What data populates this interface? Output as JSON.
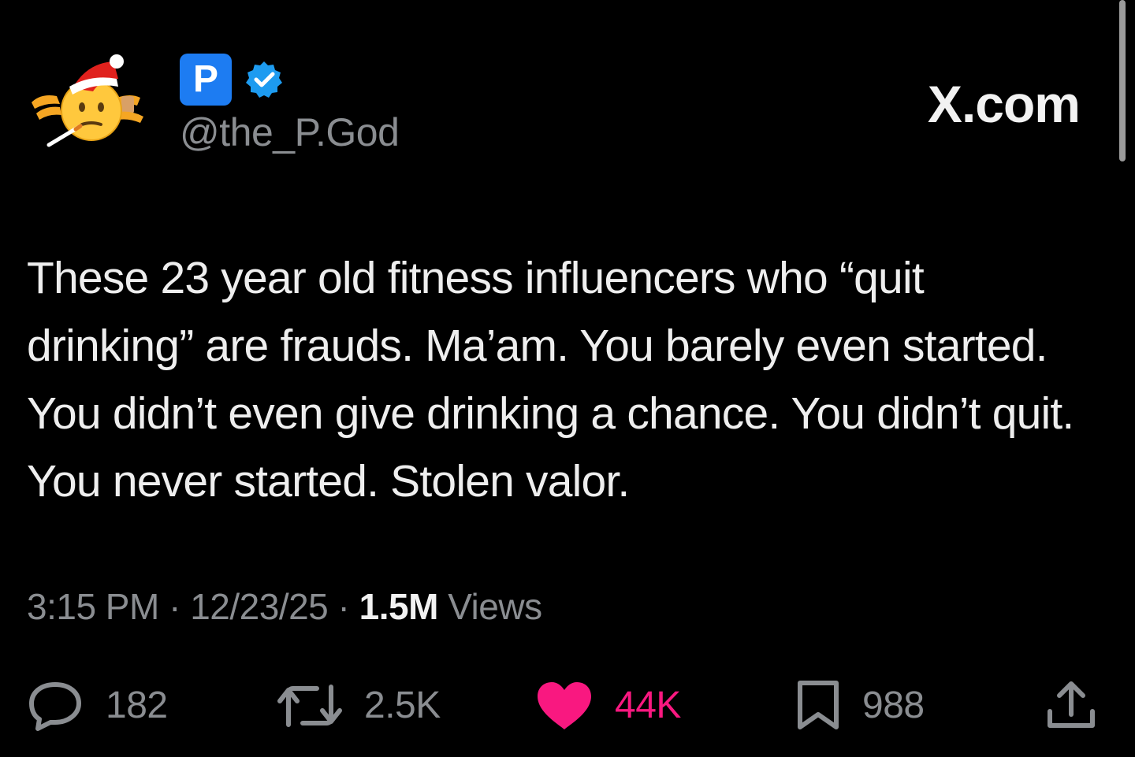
{
  "header": {
    "badge_letter": "P",
    "handle": "@the_P.God",
    "brand": "X.com"
  },
  "tweet": {
    "text": "These 23 year old fitness influencers who “quit drinking” are frauds. Ma’am. You barely even started. You didn’t even give drinking a chance. You didn’t quit. You never started. Stolen valor."
  },
  "meta": {
    "time": "3:15 PM",
    "separator": "·",
    "date": "12/23/25",
    "views_count": "1.5M",
    "views_label": "Views"
  },
  "actions": {
    "replies": "182",
    "reposts": "2.5K",
    "likes": "44K",
    "bookmarks": "988"
  },
  "icons": {
    "avatar": "santa-hat-emoji-avatar-icon",
    "verified": "verified-checkmark-icon",
    "reply": "speech-bubble-icon",
    "repost": "repost-arrows-icon",
    "like": "heart-icon",
    "bookmark": "bookmark-icon",
    "share": "share-upload-icon"
  },
  "colors": {
    "background": "#000000",
    "accent_blue": "#1d9bf0",
    "like_pink": "#f91880",
    "muted_text": "#8a8d91"
  }
}
